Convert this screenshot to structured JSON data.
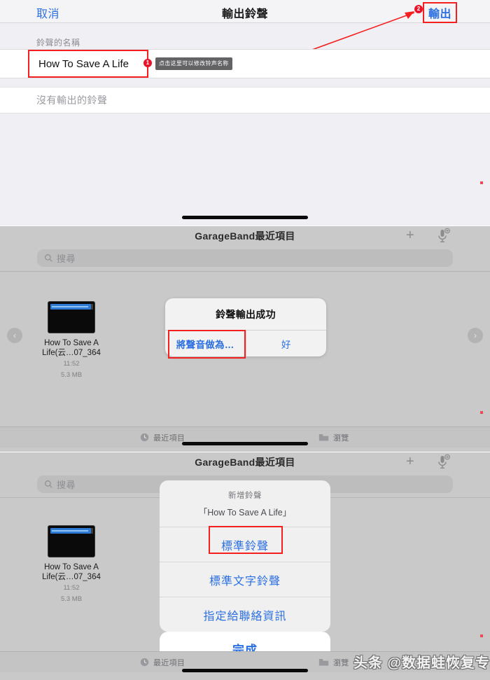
{
  "panel_export": {
    "nav": {
      "cancel_label": "取消",
      "title": "輸出鈴聲",
      "export_label": "輸出",
      "step_badge_export": "2"
    },
    "section_label": "鈴聲的名稱",
    "ringtone_name_value": "How To Save A Life",
    "ringtone_name_placeholder": "鈴聲的名稱",
    "tooltip_text": "点击这里可以修改铃声名称",
    "step_badge_name": "1",
    "empty_state": "沒有輸出的鈴聲"
  },
  "panel_alert": {
    "header": {
      "title": "GarageBand最近項目",
      "add_icon": "plus-icon",
      "mic_icon": "microphone-add-icon"
    },
    "search": {
      "placeholder": "搜尋",
      "icon": "search-icon"
    },
    "file": {
      "name_line1": "How To Save A",
      "name_line2": "Life(云…07_364",
      "time": "11:52",
      "size": "5.3 MB"
    },
    "carousel": {
      "prev": "‹",
      "next": "›"
    },
    "alert": {
      "title": "鈴聲輸出成功",
      "button_primary": "將聲音做為…",
      "button_secondary": "好"
    },
    "tabbar": {
      "recent_label": "最近項目",
      "recent_icon": "clock-icon",
      "browse_label": "瀏覽",
      "browse_icon": "folder-icon"
    }
  },
  "panel_sheet": {
    "header": {
      "title": "GarageBand最近項目",
      "add_icon": "plus-icon",
      "mic_icon": "microphone-add-icon"
    },
    "search": {
      "placeholder": "搜尋",
      "icon": "search-icon"
    },
    "file": {
      "name_line1": "How To Save A",
      "name_line2": "Life(云…07_364",
      "time": "11:52",
      "size": "5.3 MB"
    },
    "sheet": {
      "title": "新增鈴聲",
      "subtitle": "「How To Save A Life」",
      "options": [
        "標準鈴聲",
        "標準文字鈴聲",
        "指定給聯絡資訊"
      ],
      "done_label": "完成"
    },
    "tabbar": {
      "recent_label": "最近項目",
      "recent_icon": "clock-icon",
      "browse_label": "瀏覽",
      "browse_icon": "folder-icon"
    }
  },
  "watermark": "头条 @数据蛙恢复专家",
  "colors": {
    "accent_blue": "#2b6fe0",
    "highlight_red": "#f42020",
    "badge_red": "#e8152a",
    "panel_grey": "#c9c9c9",
    "sheet_grey": "#f0f0f0"
  }
}
